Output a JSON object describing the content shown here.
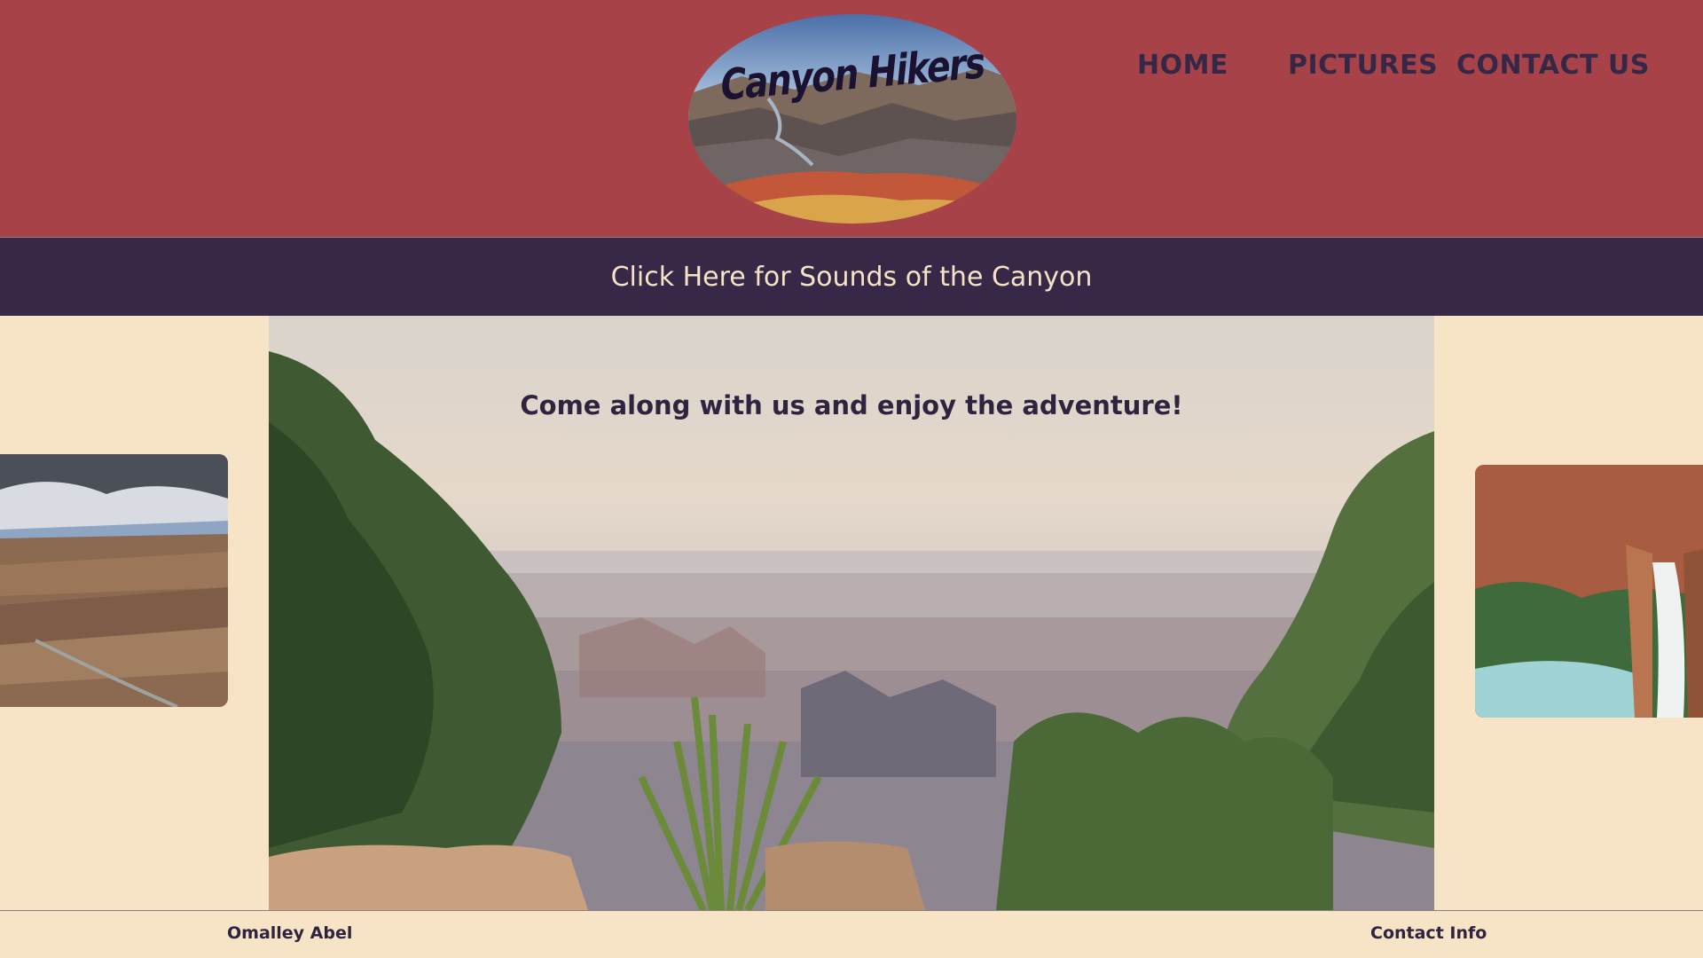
{
  "header": {
    "logo_text": "Canyon Hikers",
    "nav": {
      "home": "HOME",
      "pictures": "PICTURES",
      "contact": "CONTACT US"
    }
  },
  "soundbar": {
    "label": "Click Here for Sounds of the Canyon"
  },
  "main": {
    "tagline": "Come along with us and enjoy the adventure!"
  },
  "footer": {
    "author": "Omalley Abel",
    "contact_info": "Contact Info"
  },
  "colors": {
    "header_bg": "#a84249",
    "nav_text": "#352847",
    "soundbar_bg": "#372848",
    "soundbar_text": "#f6e2c4",
    "page_bg": "#f7e3c6"
  }
}
